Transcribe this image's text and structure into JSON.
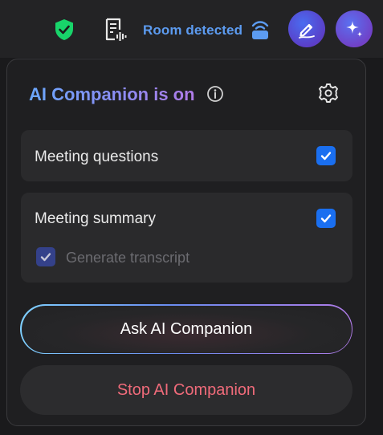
{
  "topbar": {
    "room_status": "Room detected",
    "icons": {
      "security": "shield-check-icon",
      "transcript": "transcript-icon",
      "room": "room-signal-icon",
      "whiteboard": "pen-icon",
      "ai_companion": "sparkle-icon"
    }
  },
  "panel": {
    "title": "AI Companion is on",
    "info_icon": "info-icon",
    "settings_icon": "gear-icon",
    "options": {
      "meeting_questions": {
        "label": "Meeting questions",
        "checked": true
      },
      "meeting_summary": {
        "label": "Meeting summary",
        "checked": true
      },
      "generate_transcript": {
        "label": "Generate transcript",
        "checked": true,
        "disabled": true
      }
    },
    "ask_button": "Ask AI Companion",
    "stop_button": "Stop AI Companion"
  },
  "colors": {
    "accent_blue": "#1a6ff0",
    "room_text": "#5c9bf0",
    "stop_text": "#f06b7a",
    "shield_green": "#18d46a"
  }
}
